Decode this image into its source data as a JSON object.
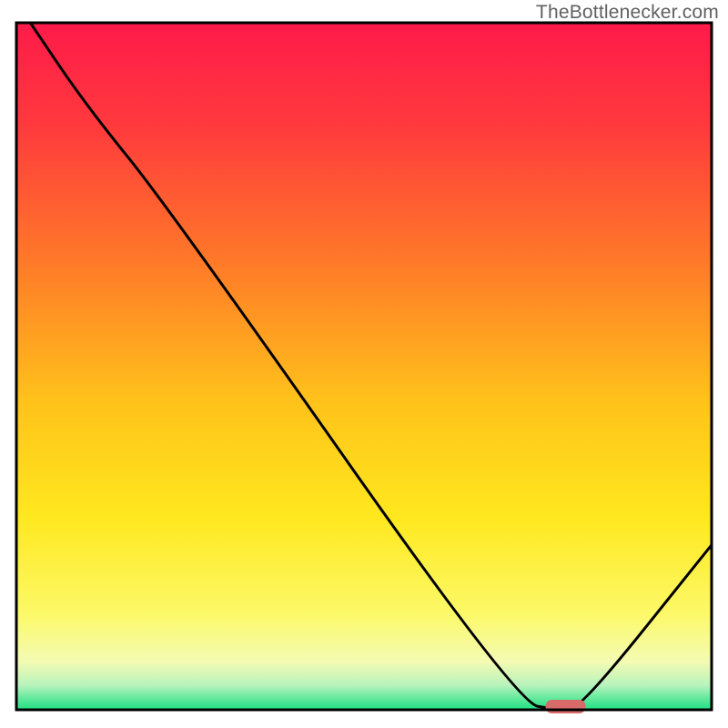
{
  "watermark": "TheBottlenecker.com",
  "chart_data": {
    "type": "line",
    "title": "",
    "xlabel": "",
    "ylabel": "",
    "xlim": [
      0,
      100
    ],
    "ylim": [
      0,
      100
    ],
    "x": [
      2,
      10,
      22,
      72,
      78,
      81,
      100
    ],
    "y": [
      100,
      88,
      73,
      1,
      0,
      0,
      24
    ],
    "marker": {
      "x": 79,
      "y": 0,
      "color": "#d96a6a"
    },
    "gradient_stops": [
      {
        "offset": 0.0,
        "color": "#ff1a4a"
      },
      {
        "offset": 0.15,
        "color": "#ff3a3d"
      },
      {
        "offset": 0.35,
        "color": "#ff7a28"
      },
      {
        "offset": 0.55,
        "color": "#ffc21a"
      },
      {
        "offset": 0.72,
        "color": "#ffe81e"
      },
      {
        "offset": 0.86,
        "color": "#fcf968"
      },
      {
        "offset": 0.93,
        "color": "#f4fbb3"
      },
      {
        "offset": 0.965,
        "color": "#b6f3bc"
      },
      {
        "offset": 0.985,
        "color": "#5be89a"
      },
      {
        "offset": 1.0,
        "color": "#1fdf83"
      }
    ]
  }
}
